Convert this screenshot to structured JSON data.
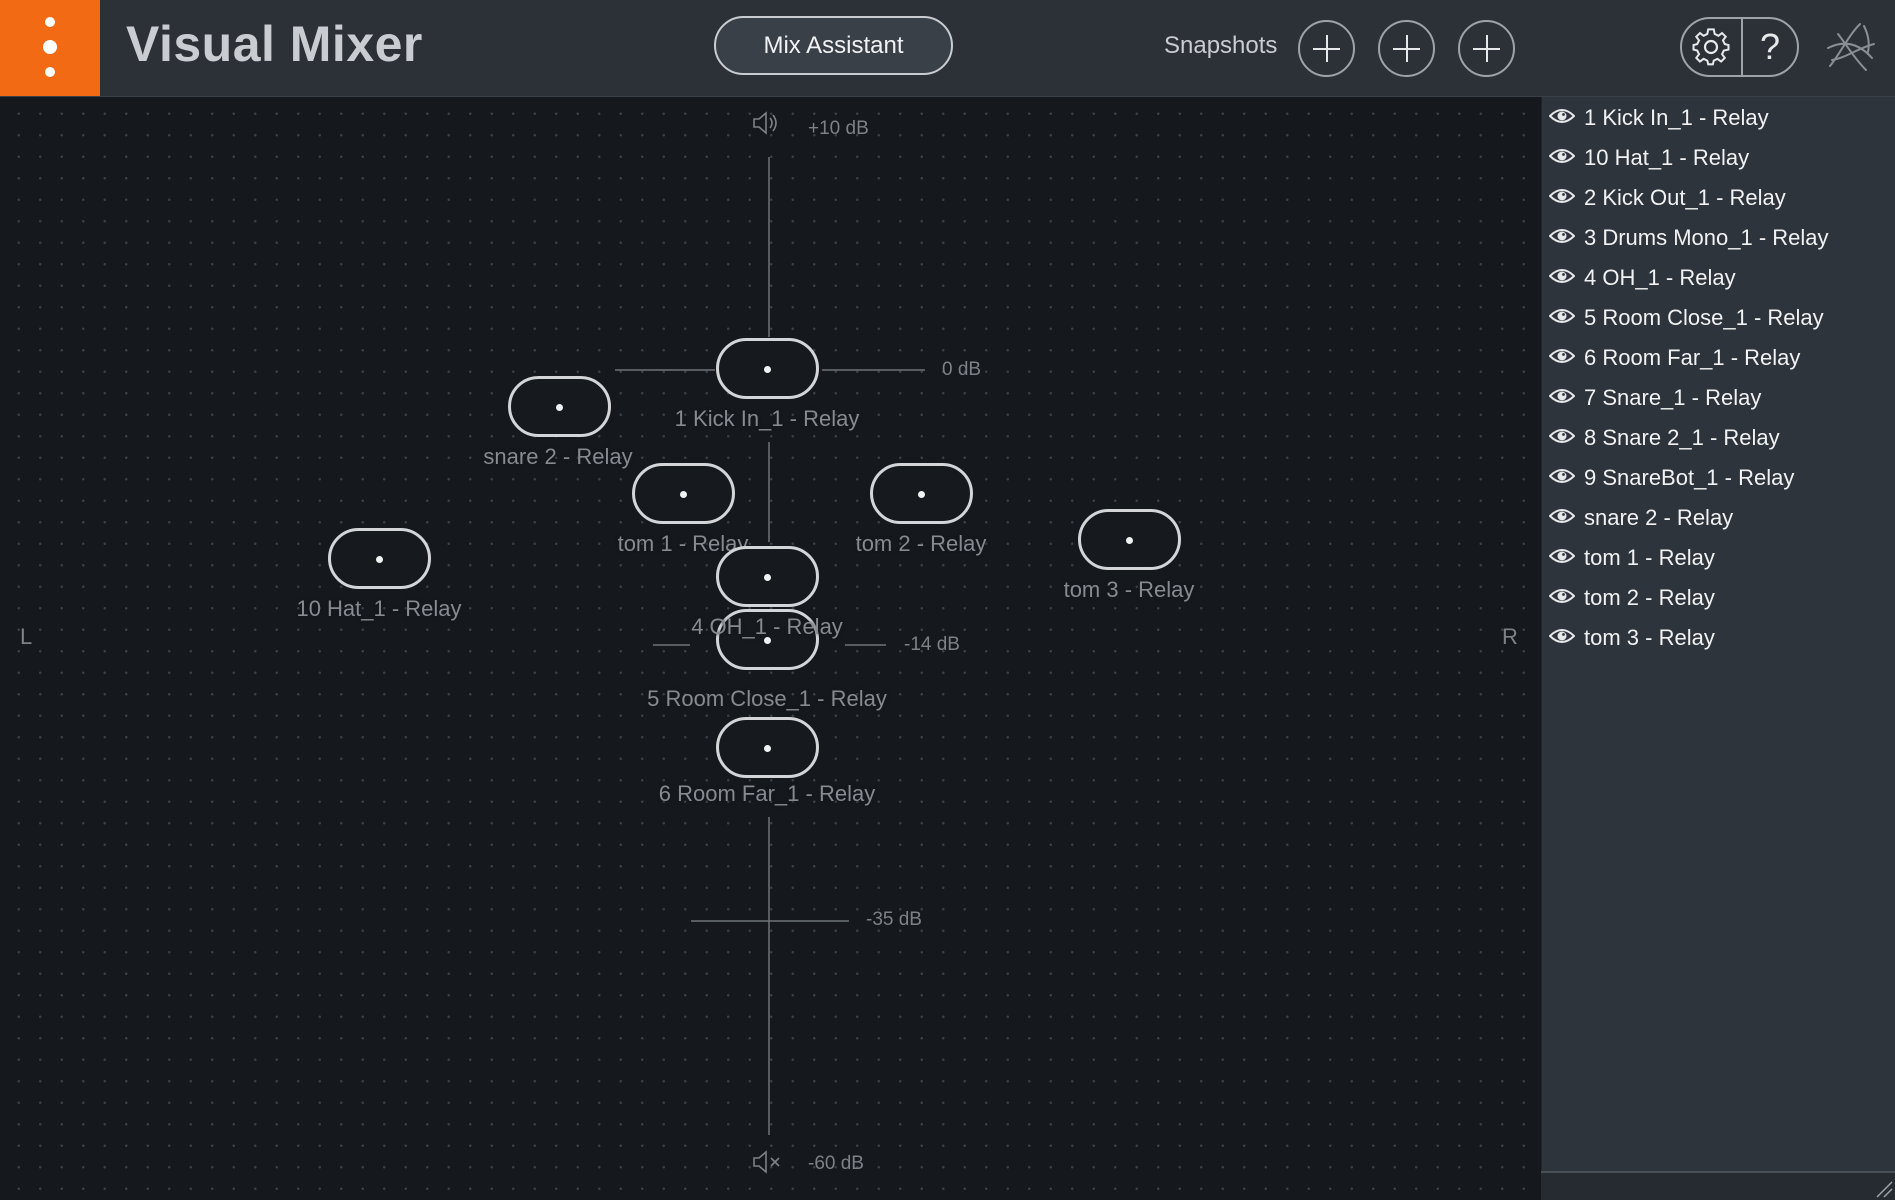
{
  "app": {
    "title": "Visual Mixer",
    "accent_color": "#f26b14",
    "menu_icon": "vertical-dots-icon"
  },
  "header": {
    "mix_assistant_label": "Mix Assistant",
    "snapshots_label": "Snapshots",
    "snapshot_icon": "plus-icon",
    "settings_icon": "gear-icon",
    "help_label": "?",
    "logo_icon": "izotope-logo-icon"
  },
  "stage": {
    "left_label": "L",
    "right_label": "R",
    "db_markers": {
      "max": "+10 dB",
      "zero": "0 dB",
      "mid": "-14 dB",
      "low": "-35 dB",
      "min": "-60 dB"
    },
    "tracks": [
      {
        "label": "1 Kick In_1 - Relay"
      },
      {
        "label": "snare 2 - Relay"
      },
      {
        "label": "tom 1 - Relay"
      },
      {
        "label": "tom 2 - Relay"
      },
      {
        "label": "10 Hat_1 - Relay"
      },
      {
        "label": "tom 3 - Relay"
      },
      {
        "label": "4 OH_1 - Relay"
      },
      {
        "label": "5 Room Close_1 - Relay"
      },
      {
        "label": "6 Room Far_1 - Relay"
      }
    ]
  },
  "track_list": [
    {
      "label": "1 Kick In_1 - Relay",
      "visible": true
    },
    {
      "label": "10 Hat_1 - Relay",
      "visible": true
    },
    {
      "label": "2 Kick Out_1 - Relay",
      "visible": true
    },
    {
      "label": "3 Drums Mono_1 - Relay",
      "visible": true
    },
    {
      "label": "4 OH_1 - Relay",
      "visible": true
    },
    {
      "label": "5 Room Close_1 - Relay",
      "visible": true
    },
    {
      "label": "6 Room Far_1 - Relay",
      "visible": true
    },
    {
      "label": "7 Snare_1 - Relay",
      "visible": true
    },
    {
      "label": "8 Snare 2_1 - Relay",
      "visible": true
    },
    {
      "label": "9 SnareBot_1 - Relay",
      "visible": true
    },
    {
      "label": "snare 2 - Relay",
      "visible": true
    },
    {
      "label": "tom 1 - Relay",
      "visible": true
    },
    {
      "label": "tom 2 - Relay",
      "visible": true
    },
    {
      "label": "tom 3 - Relay",
      "visible": true
    }
  ]
}
